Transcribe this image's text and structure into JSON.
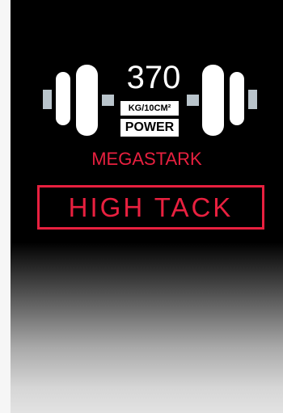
{
  "label": {
    "weight_value": "370",
    "weight_unit": "KG/10CM²",
    "power_label": "POWER",
    "brand_name": "MEGASTARK",
    "tack_label": "HIGH TACK"
  },
  "icons": {
    "main_icon": "dumbbell-icon"
  },
  "colors": {
    "accent_red": "#e8203f",
    "background_black": "#000000",
    "plate_white": "#ffffff",
    "end_cap_grey": "#b9c4cb"
  }
}
